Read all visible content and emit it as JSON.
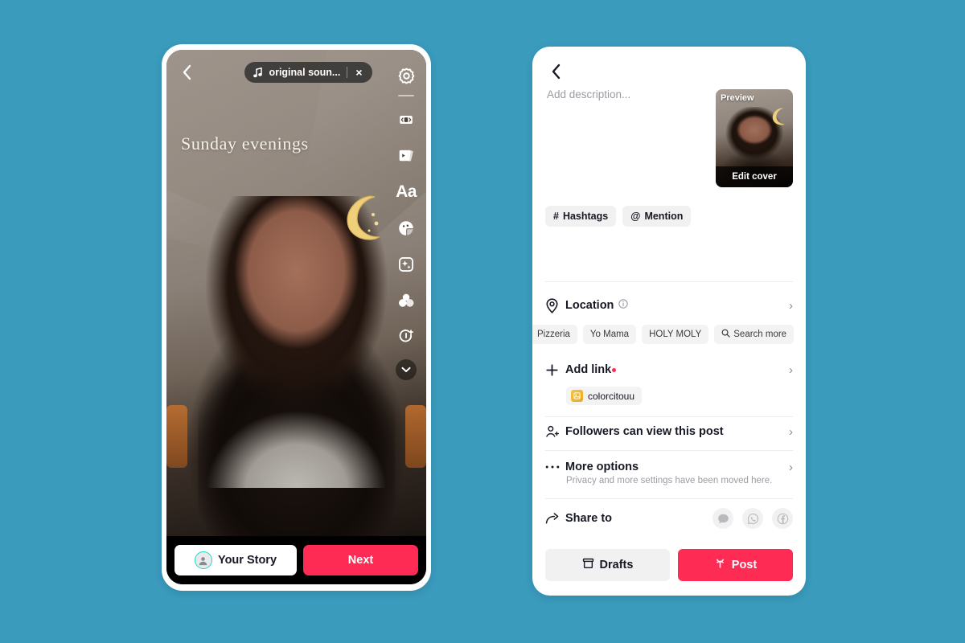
{
  "canvas": {
    "background_color": "#3a9bbd"
  },
  "left_phone": {
    "topbar": {
      "back_icon": "chevron-left-icon",
      "sound_music_icon": "music-note-icon",
      "sound_label": "original soun...",
      "close_label": "×"
    },
    "overlay_text": "Sunday evenings",
    "sticker": "crescent-moon-sticker",
    "tools": [
      {
        "name": "settings-gear-icon",
        "label": ""
      },
      {
        "name": "flip-camera-icon",
        "label": ""
      },
      {
        "name": "templates-cards-icon",
        "label": ""
      },
      {
        "name": "text-tool-icon",
        "label": "Aa"
      },
      {
        "name": "stickers-emoji-icon",
        "label": ""
      },
      {
        "name": "effects-sparkle-icon",
        "label": ""
      },
      {
        "name": "filters-circles-icon",
        "label": ""
      },
      {
        "name": "voice-effects-icon",
        "label": ""
      },
      {
        "name": "chevron-down-icon",
        "label": ""
      }
    ],
    "bottom": {
      "your_story_label": "Your Story",
      "your_story_avatar": "avatar-icon",
      "next_label": "Next"
    }
  },
  "right_panel": {
    "back_icon": "chevron-left-icon",
    "description": {
      "placeholder": "Add description...",
      "value": ""
    },
    "preview": {
      "badge_label": "Preview",
      "edit_cover_label": "Edit cover"
    },
    "quick_chips": [
      {
        "icon": "hashtag-icon",
        "label": "Hashtags",
        "glyph": "#"
      },
      {
        "icon": "at-mention-icon",
        "label": "Mention",
        "glyph": "@"
      }
    ],
    "location": {
      "icon": "location-pin-icon",
      "label": "Location",
      "info_icon": "info-circle-icon",
      "chevron": "›",
      "suggestions": [
        {
          "label": "Pizzeria",
          "icon": ""
        },
        {
          "label": "Yo Mama",
          "icon": ""
        },
        {
          "label": "HOLY MOLY",
          "icon": ""
        },
        {
          "label": "Search more",
          "icon": "search-icon"
        }
      ]
    },
    "add_link": {
      "icon": "plus-icon",
      "label": "Add link",
      "has_badge": true,
      "chevron": "›",
      "linked_account": {
        "icon": "link-thumbnail-icon",
        "label": "colorcitouu"
      }
    },
    "privacy": {
      "icon": "person-check-icon",
      "label": "Followers can view this post",
      "chevron": "›"
    },
    "more_options": {
      "icon": "ellipsis-icon",
      "label": "More options",
      "subtitle": "Privacy and more settings have been moved here.",
      "chevron": "›"
    },
    "share_to": {
      "icon": "share-arrow-icon",
      "label": "Share to",
      "targets": [
        {
          "name": "messages-icon"
        },
        {
          "name": "whatsapp-icon"
        },
        {
          "name": "facebook-icon"
        }
      ]
    },
    "bottom": {
      "drafts_icon": "drafts-box-icon",
      "drafts_label": "Drafts",
      "post_icon": "post-sparkle-icon",
      "post_label": "Post"
    },
    "colors": {
      "accent": "#fe2c55",
      "chip_bg": "#f1f1f2",
      "muted_text": "#9a9ca3"
    }
  }
}
